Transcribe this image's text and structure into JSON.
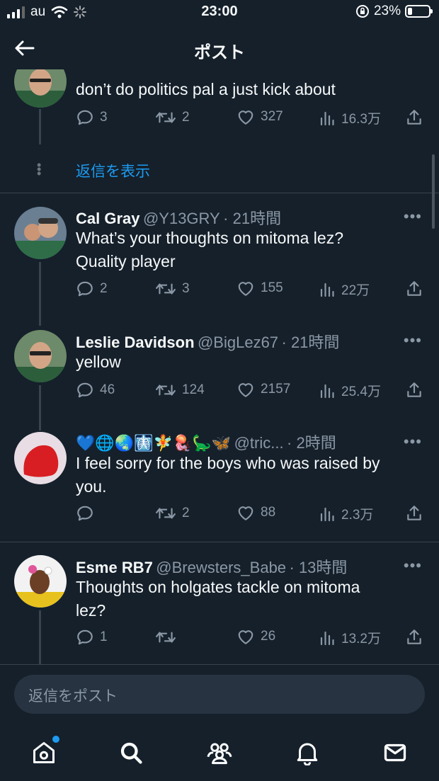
{
  "status_bar": {
    "carrier": "au",
    "time": "23:00",
    "battery": "23%",
    "battery_level": 0.23
  },
  "header": {
    "title": "ポスト"
  },
  "thread_top": {
    "text": "don’t do politics pal a just kick about",
    "replies": "3",
    "retweets": "2",
    "likes": "327",
    "views": "16.3万",
    "show_replies": "返信を表示"
  },
  "tweets": [
    {
      "name": "Cal Gray",
      "handle": "@Y13GRY",
      "time": "· 21時間",
      "text_lines": [
        "What’s your thoughts on mitoma lez?",
        "Quality player"
      ],
      "replies": "2",
      "retweets": "3",
      "likes": "155",
      "views": "22万"
    },
    {
      "name": "Leslie Davidson",
      "handle": "@BigLez67",
      "time": "· 21時間",
      "text_lines": [
        "yellow"
      ],
      "replies": "46",
      "retweets": "124",
      "likes": "2157",
      "views": "25.4万"
    },
    {
      "name": "💙🌐🌏🩻🧚🪼🦕🦋",
      "handle": "@tric...",
      "time": "· 2時間",
      "text_lines": [
        "I feel sorry for the boys who was raised by",
        "you."
      ],
      "replies": "",
      "retweets": "2",
      "likes": "88",
      "views": "2.3万"
    },
    {
      "name": "Esme RB7",
      "handle": "@Brewsters_Babe",
      "time": "· 13時間",
      "text_lines": [
        "Thoughts on holgates tackle on mitoma",
        "lez?"
      ],
      "replies": "1",
      "retweets": "",
      "likes": "26",
      "views": "13.2万"
    }
  ],
  "reply_box": {
    "placeholder": "返信をポスト"
  },
  "more_label": "•••",
  "colors": {
    "background": "#15202b",
    "accent": "#1d9bf0",
    "muted": "#8b98a5",
    "divider": "#38444d"
  },
  "icons": [
    "back-arrow-icon",
    "reply-icon",
    "retweet-icon",
    "like-icon",
    "views-icon",
    "share-icon",
    "home-icon",
    "search-icon",
    "communities-icon",
    "notifications-icon",
    "messages-icon"
  ]
}
